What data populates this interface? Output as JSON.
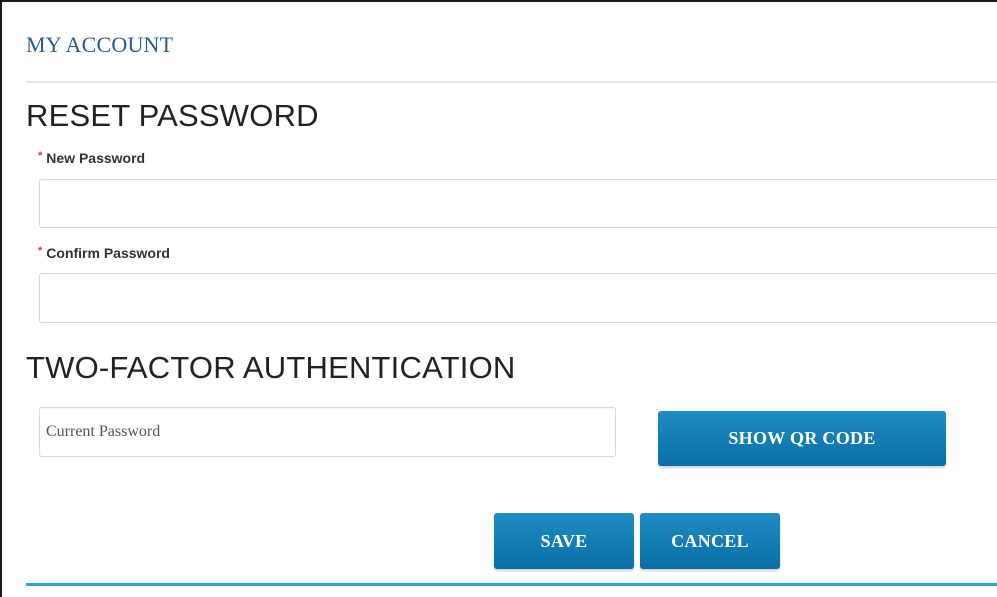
{
  "header": {
    "title": "MY ACCOUNT"
  },
  "reset_password": {
    "heading": "RESET PASSWORD",
    "new_password": {
      "required_marker": "*",
      "label": "New Password",
      "value": "",
      "placeholder": ""
    },
    "confirm_password": {
      "required_marker": "*",
      "label": "Confirm Password",
      "value": "",
      "placeholder": ""
    }
  },
  "two_factor": {
    "heading": "TWO-FACTOR AUTHENTICATION",
    "current_password": {
      "value": "",
      "placeholder": "Current Password"
    },
    "show_qr_label": "SHOW QR CODE"
  },
  "actions": {
    "save_label": "SAVE",
    "cancel_label": "CANCEL"
  },
  "colors": {
    "title": "#2a5d8f",
    "button": "#0f7db5",
    "required": "#d9342b",
    "accent_line": "#2aa6d4"
  }
}
